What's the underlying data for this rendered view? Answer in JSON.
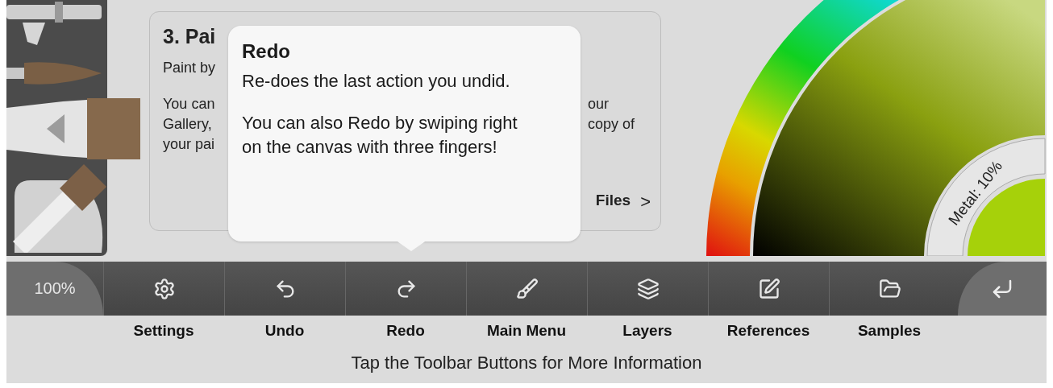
{
  "brush_tools": [
    {
      "kind": "airbrush"
    },
    {
      "kind": "round"
    },
    {
      "kind": "flat"
    },
    {
      "kind": "angled"
    }
  ],
  "tutorial_card": {
    "title": "3. Pai",
    "lead": "Paint by",
    "left_lines": [
      "You can",
      "Gallery,",
      "your pai"
    ],
    "right_lines": [
      "our",
      "copy of"
    ],
    "link": "Files",
    "link_arrow": ">"
  },
  "tooltip": {
    "title": "Redo",
    "paragraphs": [
      "Re-does the last action you undid.",
      "You can also Redo by swiping right on the canvas with three fingers!"
    ]
  },
  "color_picker": {
    "metal_label": "Metal: 10%",
    "color": "#a6d10a"
  },
  "toolbar": {
    "zoom": "100%",
    "buttons": [
      {
        "kind": "settings",
        "label": "Settings"
      },
      {
        "kind": "undo",
        "label": "Undo"
      },
      {
        "kind": "redo",
        "label": "Redo"
      },
      {
        "kind": "main_menu",
        "label": "Main Menu"
      },
      {
        "kind": "layers",
        "label": "Layers"
      },
      {
        "kind": "references",
        "label": "References"
      },
      {
        "kind": "samples",
        "label": "Samples"
      }
    ]
  },
  "hint": "Tap the Toolbar Buttons for More Information"
}
